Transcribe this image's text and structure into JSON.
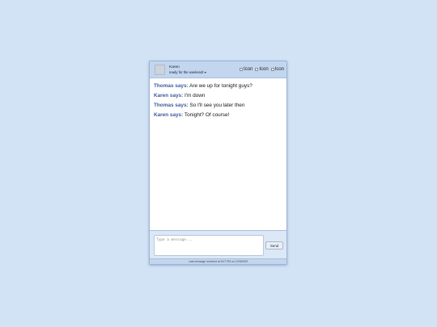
{
  "header": {
    "contact_name": "Karen",
    "status_message": "ready for the weekend!",
    "status_chevron": "▾",
    "avatar_text": "",
    "icons": [
      {
        "name": "icon-1",
        "alt": "Icon"
      },
      {
        "name": "icon-2",
        "alt": "Icon"
      },
      {
        "name": "icon-3",
        "alt": "Icon"
      }
    ]
  },
  "messages": [
    {
      "sender": "Thomas says:",
      "text": "Are we up for tonight guys?"
    },
    {
      "sender": "Karen says:",
      "text": "I'm down"
    },
    {
      "sender": "Thomas says:",
      "text": "So I'll see you later then"
    },
    {
      "sender": "Karen says:",
      "text": "Tonight? Of course!"
    }
  ],
  "composer": {
    "placeholder": "Type a message...",
    "value": "",
    "send_label": "Send"
  },
  "footer": {
    "status_text": "Last message received at 5:07 PM on 2/23/2009"
  }
}
